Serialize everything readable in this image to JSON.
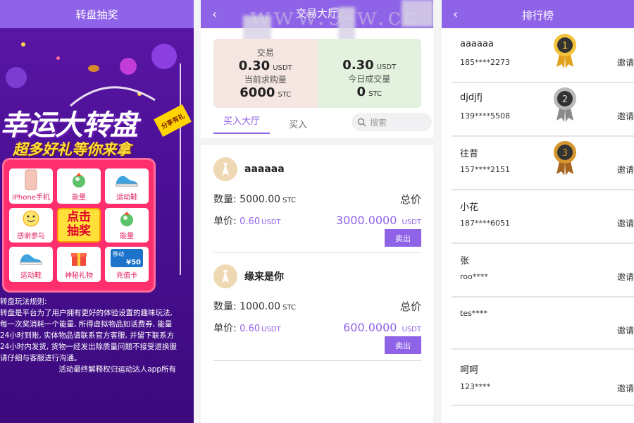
{
  "lottery": {
    "header_title": "转盘抽奖",
    "big_title": "幸运大转盘",
    "subtitle": "超多好礼等你来拿",
    "share_tag": "分享有礼",
    "prizes": [
      {
        "label": "iPhone手机",
        "icon": "phone-icon"
      },
      {
        "label": "能量",
        "icon": "energy-icon"
      },
      {
        "label": "运动鞋",
        "icon": "shoe-icon"
      },
      {
        "label": "感谢参与",
        "icon": "smile-icon"
      },
      {
        "label": "点击抽奖",
        "icon": ""
      },
      {
        "label": "能量",
        "icon": "energy-icon"
      },
      {
        "label": "运动鞋",
        "icon": "shoe-icon"
      },
      {
        "label": "神秘礼物",
        "icon": "gift-icon"
      },
      {
        "label": "充值卡",
        "icon": "card-icon"
      }
    ],
    "card_text": "移动",
    "card_amount": "¥50",
    "rules_lines": [
      "转盘玩法规则:",
      "转盘是平台为了用户拥有更好的体验设置的趣味玩法,",
      "每一次奖消耗一个能量, 所得虚拟物品如话费券, 能量",
      "24小时到账, 实体物品请联系官方客服, 并留下联系方",
      "24小时内发货, 货物一经发出除质量问题不接受退换服",
      "请仔细与客服进行沟通。"
    ],
    "rules_footer": "活动最终解释权归运动达人app所有"
  },
  "trading": {
    "back_icon": "chevron-left-icon",
    "header_title": "交易大厅",
    "watermark": "www.9-w.cc",
    "stats": {
      "left_top_label": "交易",
      "left_top_value": "0.30",
      "left_top_unit": "USDT",
      "left_bottom_label": "当前求购量",
      "left_bottom_value": "6000",
      "left_bottom_unit": "STC",
      "right_top_value": "0.30",
      "right_top_unit": "USDT",
      "right_bottom_label": "今日成交量",
      "right_bottom_value": "0",
      "right_bottom_unit": "STC"
    },
    "tabs": [
      "买入大厅",
      "买入"
    ],
    "search_placeholder": "搜索",
    "orders": [
      {
        "user": "aaaaaa",
        "qty_label": "数量:",
        "qty": "5000.00",
        "qty_unit": "STC",
        "total_label": "总价",
        "price_label": "单价:",
        "price": "0.60",
        "price_unit": "USDT",
        "total": "3000.0000",
        "total_unit": "USDT",
        "btn": "卖出"
      },
      {
        "user": "缘来是你",
        "qty_label": "数量:",
        "qty": "1000.00",
        "qty_unit": "STC",
        "total_label": "总价",
        "price_label": "单价:",
        "price": "0.60",
        "price_unit": "USDT",
        "total": "600.0000",
        "total_unit": "USDT",
        "btn": "卖出"
      }
    ]
  },
  "ranking": {
    "header_title": "排行榜",
    "items": [
      {
        "name": "aaaaaa",
        "phone": "185****2273",
        "medal": "1",
        "invite": "邀请"
      },
      {
        "name": "djdjfj",
        "phone": "139****5508",
        "medal": "2",
        "invite": "邀请"
      },
      {
        "name": "往昔",
        "phone": "157****2151",
        "medal": "3",
        "invite": "邀请"
      },
      {
        "name": "小花",
        "phone": "187****6051",
        "medal": "",
        "invite": "邀请"
      },
      {
        "name": "张",
        "phone": "roo****",
        "medal": "",
        "invite": "邀请"
      },
      {
        "name": "tes****",
        "phone": "",
        "medal": "",
        "invite": "邀请"
      },
      {
        "name": "呵呵",
        "phone": "123****",
        "medal": "",
        "invite": "邀请"
      }
    ],
    "colors": {
      "accent": "#8f63e8",
      "gold": "#e8b22a",
      "silver": "#9a9a9a",
      "bronze": "#c98a2d"
    }
  }
}
